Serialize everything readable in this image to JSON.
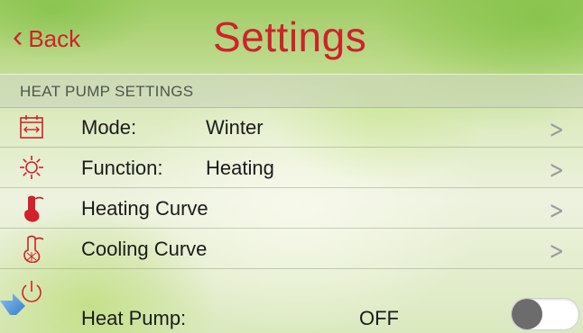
{
  "header": {
    "back_label": "Back",
    "title": "Settings"
  },
  "section": {
    "label": "HEAT PUMP SETTINGS"
  },
  "rows": [
    {
      "label": "Mode:",
      "value": "Winter",
      "icon": "calendar-range-icon"
    },
    {
      "label": "Function:",
      "value": "Heating",
      "icon": "sun-icon"
    },
    {
      "label": "Heating Curve",
      "icon": "thermometer-hot-icon"
    },
    {
      "label": "Cooling Curve",
      "icon": "thermometer-cold-icon"
    }
  ],
  "heat_pump": {
    "label": "Heat Pump:",
    "status": "OFF",
    "icon": "power-icon",
    "enabled": false
  },
  "colors": {
    "accent": "#d0212c",
    "text": "#1b1b1b",
    "section_text": "#4e564b",
    "chevron": "#9c9c9c",
    "toggle_knob": "#6c6c6c"
  }
}
